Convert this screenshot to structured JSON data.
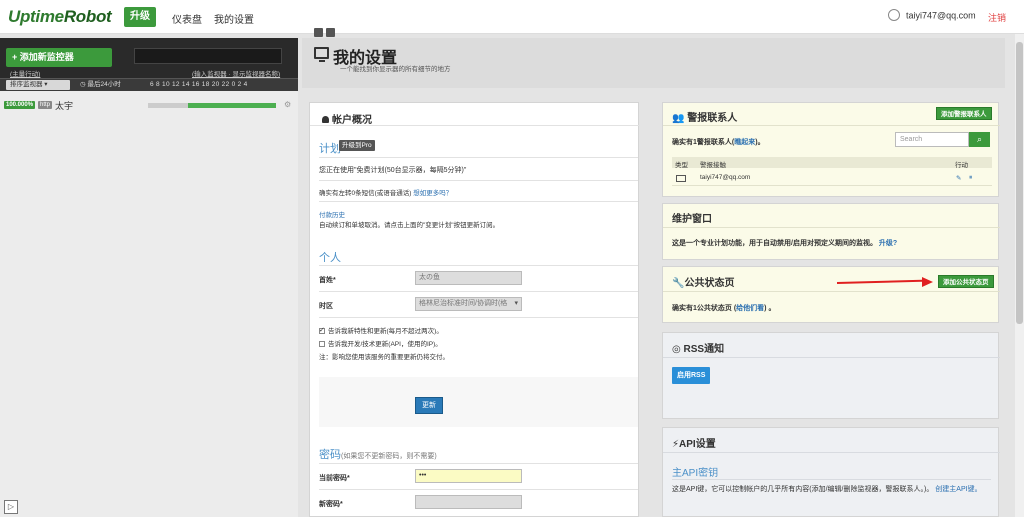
{
  "topnav": {
    "logo_part1": "Uptime",
    "logo_part2": "Robot",
    "upgrade": "升级",
    "dashboard": "仪表盘",
    "my_settings": "我的设置",
    "user_email": "taiyi747@qq.com",
    "logout": "注销"
  },
  "sidebar": {
    "add_monitor": "+ 添加新监控器",
    "bulk_actions": "(主量行动)",
    "hint": "(输入监视器 · 显示监视器名称)",
    "sort": "排序监视器 ▾",
    "last24": "◷ 最后24小时",
    "hours": "6   8   10 12 14 16 18 20 22  0   2   4",
    "monitor": {
      "uptime": "100.000%",
      "type": "http",
      "name": "太宇",
      "uptime_fraction": 0.69
    },
    "collapse": "▷"
  },
  "header": {
    "title": "我的设置",
    "subtitle": "一个能找到你显示器的所有细节的地方"
  },
  "account": {
    "title": "帐户概况",
    "plan_title": "计划",
    "pro_badge": "升级到Pro",
    "plan_desc": "您正在使用\"免费计划(50台显示器，每隔5分钟)\"",
    "sms_desc": "确实有左转0条短信(或语音通话)",
    "sms_link": "想如更多吗？",
    "billing_title": "付款历史",
    "billing_desc": "自动续订和单坡取消。请点击上面的\"变更计划\"按钮更新订阅。",
    "personal_title": "个人",
    "name_label": "首姓*",
    "name_value": "太の鱼",
    "tz_label": "时区",
    "tz_value": "格林尼治标准时间/协调时(格",
    "chk1": "告诉我新特性和更新(每月不超过两次)。",
    "chk2": "告诉我开发/技术更新(API，使用的IP)。",
    "note": "注：影响您使用该服务的重要更新仍将交付。",
    "save": "更新",
    "password_title": "密码",
    "password_hint": "(如果您不更新密码，则不需要)",
    "current_pw_label": "当前密码*",
    "current_pw_value": "•••",
    "new_pw_label": "新密码*"
  },
  "alerts": {
    "title": "警报联系人",
    "add": "添加警报联系人",
    "count_text": "确实有1警报联系人(",
    "count_link": "瞧起来",
    "count_end": ")。",
    "search_placeholder": "Search",
    "col_type": "类型",
    "col_contact": "警报接触",
    "col_action": "行动",
    "contact_email": "taiyi747@qq.com"
  },
  "maintenance": {
    "title": "维护窗口",
    "desc": "这是一个专业计划功能，用于自动禁用/启用对预定义期间的监视。",
    "link": "升级?"
  },
  "status_page": {
    "title": "公共状态页",
    "add": "添加公共状态页",
    "desc": "确实有1公共状态页 (",
    "link": "给他们看",
    "end": ") 。"
  },
  "rss": {
    "title": "RSS通知",
    "enable": "启用RSS"
  },
  "api": {
    "title": "API设置",
    "main_key": "主API密钥",
    "desc": "这是API键，它可以控制帐户的几乎所有内容(添加/编辑/删除监视器，警报联系人。)。",
    "create_link": "创建主API键。"
  },
  "colors": {
    "brand_green": "#3c9a3c",
    "link_blue": "#2a6fb0",
    "arrow_red": "#e02020"
  }
}
